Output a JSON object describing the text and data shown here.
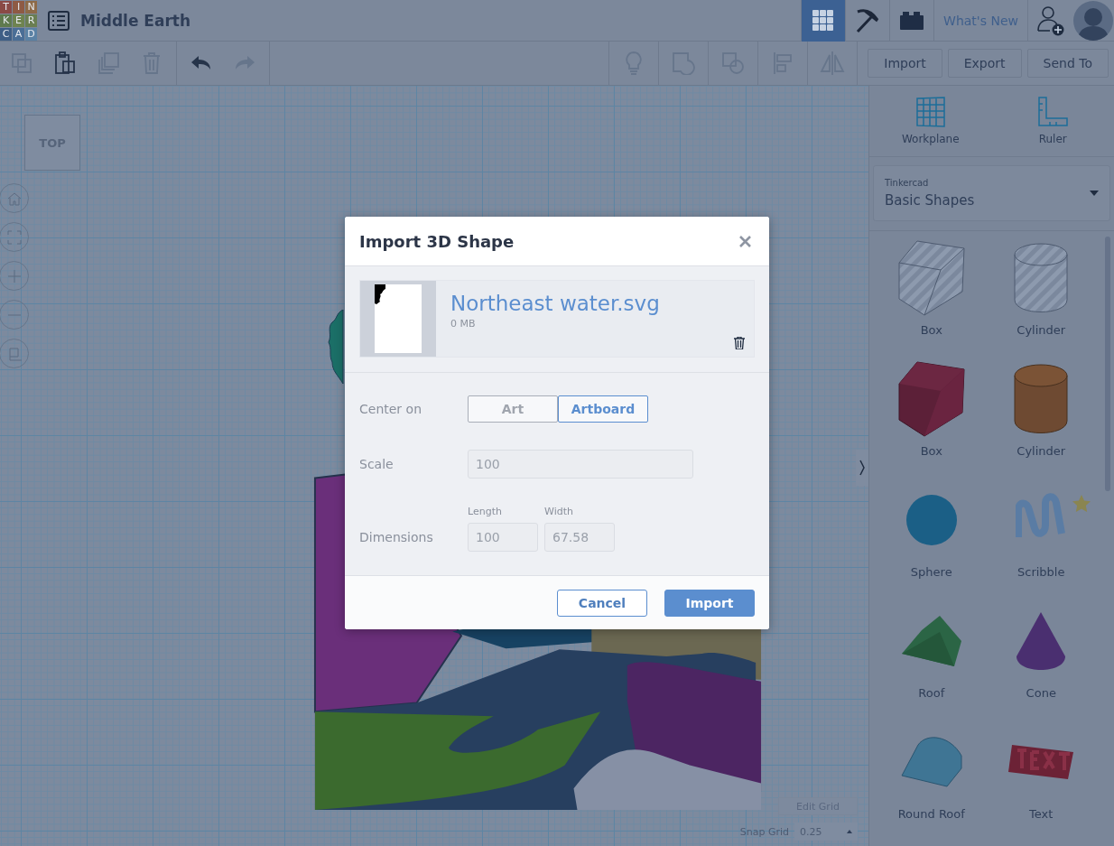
{
  "app": {
    "logo_letters": [
      "T",
      "I",
      "N",
      "K",
      "E",
      "R",
      "C",
      "A",
      "D"
    ],
    "project_title": "Middle Earth"
  },
  "top_nav": {
    "views": [
      {
        "kind": "grid",
        "selected": true
      },
      {
        "kind": "pickaxe",
        "selected": false
      },
      {
        "kind": "bricks",
        "selected": false
      }
    ],
    "whats_new": "What's New"
  },
  "edit_tools": [
    {
      "kind": "copy",
      "disabled": true
    },
    {
      "kind": "paste",
      "disabled": false
    },
    {
      "kind": "duplicate",
      "disabled": true
    },
    {
      "kind": "delete",
      "disabled": true
    },
    {
      "kind": "undo",
      "disabled": false
    },
    {
      "kind": "redo",
      "disabled": true
    }
  ],
  "shape_tools": [
    {
      "kind": "bulb",
      "disabled": true
    },
    {
      "kind": "group",
      "disabled": true
    },
    {
      "kind": "ungroup",
      "disabled": true
    },
    {
      "kind": "align",
      "disabled": true
    },
    {
      "kind": "mirror",
      "disabled": true
    }
  ],
  "actions": [
    "Import",
    "Export",
    "Send To"
  ],
  "view_cube": {
    "label": "TOP"
  },
  "grid_controls": {
    "edit_grid": "Edit Grid",
    "snap_label": "Snap Grid",
    "snap_value": "0.25"
  },
  "panel": {
    "tools": [
      {
        "kind": "workplane",
        "label": "Workplane"
      },
      {
        "kind": "ruler",
        "label": "Ruler"
      }
    ],
    "library": {
      "source": "Tinkercad",
      "name": "Basic Shapes"
    },
    "shapes": [
      {
        "kind": "box-hole",
        "label": "Box"
      },
      {
        "kind": "cylinder-hole",
        "label": "Cylinder"
      },
      {
        "kind": "box",
        "label": "Box"
      },
      {
        "kind": "cylinder",
        "label": "Cylinder"
      },
      {
        "kind": "sphere",
        "label": "Sphere"
      },
      {
        "kind": "scribble",
        "label": "Scribble"
      },
      {
        "kind": "roof",
        "label": "Roof"
      },
      {
        "kind": "cone",
        "label": "Cone"
      },
      {
        "kind": "round-roof",
        "label": "Round Roof"
      },
      {
        "kind": "text",
        "label": "Text"
      }
    ]
  },
  "dialog": {
    "title": "Import 3D Shape",
    "file": {
      "name": "Northeast water.svg",
      "size": "0 MB"
    },
    "center_on": {
      "label": "Center on",
      "options": [
        {
          "label": "Art",
          "selected": false
        },
        {
          "label": "Artboard",
          "selected": true
        }
      ]
    },
    "scale": {
      "label": "Scale",
      "value": "100"
    },
    "dimensions": {
      "label": "Dimensions",
      "fields": [
        {
          "label": "Length",
          "value": "100"
        },
        {
          "label": "Width",
          "value": "67.58"
        }
      ]
    },
    "buttons": [
      {
        "kind": "secondary",
        "label": "Cancel"
      },
      {
        "kind": "primary",
        "label": "Import"
      }
    ]
  }
}
